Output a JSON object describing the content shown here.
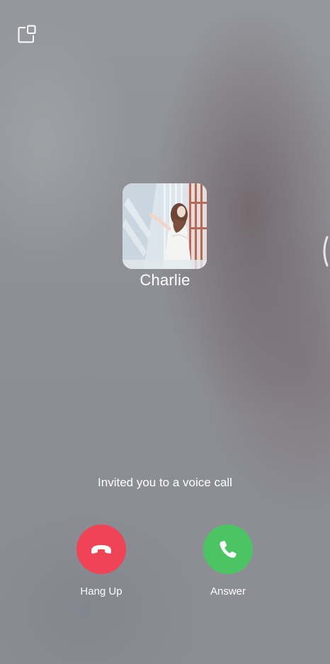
{
  "caller": {
    "name": "Charlie"
  },
  "call": {
    "status_text": "Invited you to a voice call"
  },
  "actions": {
    "hang_up_label": "Hang Up",
    "answer_label": "Answer"
  },
  "colors": {
    "hang_up": "#ee4456",
    "answer": "#4cc463"
  },
  "icons": {
    "floating_window": "floating-window-icon",
    "hang_up": "phone-hangup-icon",
    "answer": "phone-icon"
  }
}
